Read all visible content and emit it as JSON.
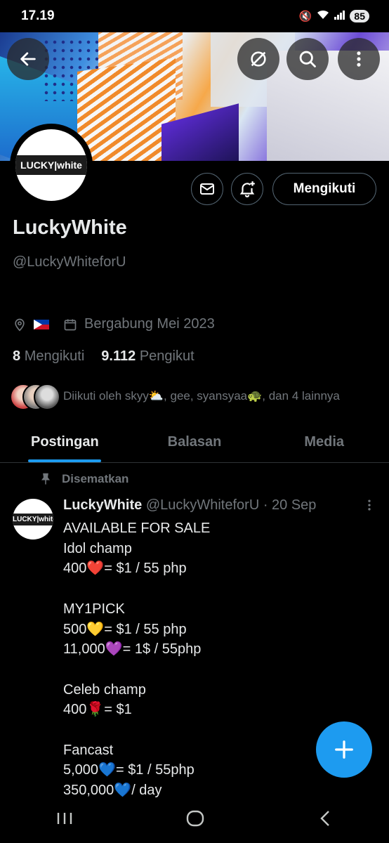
{
  "status": {
    "time": "17.19",
    "battery": "85",
    "icons": [
      "mute-icon",
      "wifi-icon",
      "signal-icon"
    ]
  },
  "header": {
    "back_icon": "arrow-left-icon",
    "actions": [
      "grok-icon",
      "search-icon",
      "more-vertical-icon"
    ]
  },
  "profile": {
    "logo_text": "LUCKY|white",
    "name": "LuckyWhite",
    "handle": "@LuckyWhiteforU",
    "joined": "Bergabung Mei 2023",
    "following_count": "8",
    "following_label": "Mengikuti",
    "followers_count": "9.112",
    "followers_label": "Pengikut",
    "followed_by": "Diikuti oleh skyy⛅, gee, syansyaa🐢, dan 4 lainnya",
    "follow_button": "Mengikuti"
  },
  "tabs": [
    {
      "label": "Postingan",
      "active": true
    },
    {
      "label": "Balasan",
      "active": false
    },
    {
      "label": "Media",
      "active": false
    }
  ],
  "post": {
    "pinned_label": "Disematkan",
    "author": "LuckyWhite",
    "meta": "@LuckyWhiteforU · 20 Sep",
    "lines": [
      "AVAILABLE FOR SALE",
      "Idol champ",
      "400❤️= $1 / 55 php",
      "",
      "MY1PICK",
      "500💛= $1 / 55 php",
      "11,000💜= 1$ / 55php",
      "",
      "Celeb champ",
      "400🌹= $1",
      "",
      "Fancast",
      "5,000💙= $1 / 55php",
      "350,000💙/ day"
    ]
  },
  "fab": {
    "icon": "plus-icon"
  },
  "nav": [
    "recent-apps-icon",
    "home-icon",
    "back-icon"
  ],
  "colors": {
    "accent": "#1d9bf0",
    "background": "#000000",
    "muted": "#71767b"
  }
}
